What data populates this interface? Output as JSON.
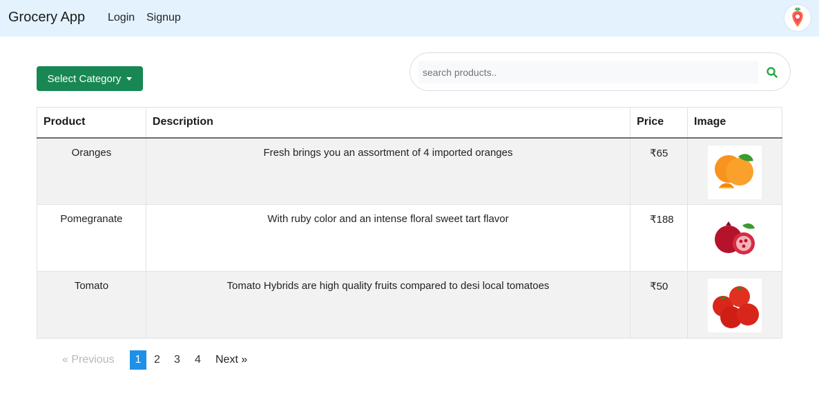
{
  "navbar": {
    "brand": "Grocery App",
    "login": "Login",
    "signup": "Signup",
    "logo_icon": "strawberry-location-pin-icon"
  },
  "filters": {
    "category_button": "Select Category",
    "search_placeholder": "search products..",
    "search_icon": "search-icon"
  },
  "table": {
    "headers": [
      "Product",
      "Description",
      "Price",
      "Image"
    ],
    "rows": [
      {
        "product": "Oranges",
        "description": "Fresh brings you an assortment of 4 imported oranges",
        "price": "₹65",
        "image": "oranges-image"
      },
      {
        "product": "Pomegranate",
        "description": "With ruby color and an intense floral sweet tart flavor",
        "price": "₹188",
        "image": "pomegranate-image"
      },
      {
        "product": "Tomato",
        "description": "Tomato Hybrids are high quality fruits compared to desi local tomatoes",
        "price": "₹50",
        "image": "tomato-image"
      }
    ]
  },
  "pagination": {
    "previous": "«  Previous",
    "pages": [
      "1",
      "2",
      "3",
      "4"
    ],
    "next": "Next  »",
    "active_page": "1"
  },
  "colors": {
    "navbar_bg": "#e3f2fd",
    "category_button": "#198754",
    "active_page": "#1e90e8",
    "search_icon": "#28a745"
  }
}
